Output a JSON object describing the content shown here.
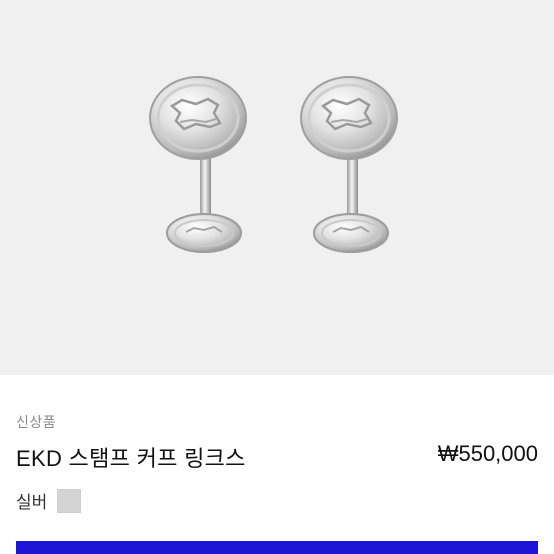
{
  "product": {
    "badge": "신상품",
    "title": "EKD 스탬프 커프 링크스",
    "price": "₩550,000",
    "color_label": "실버",
    "swatch_color": "#d4d4d4",
    "image_background": "#f0f0f0",
    "image_subject": "silver-cufflinks"
  },
  "cta": {
    "color": "#1e14d6"
  }
}
